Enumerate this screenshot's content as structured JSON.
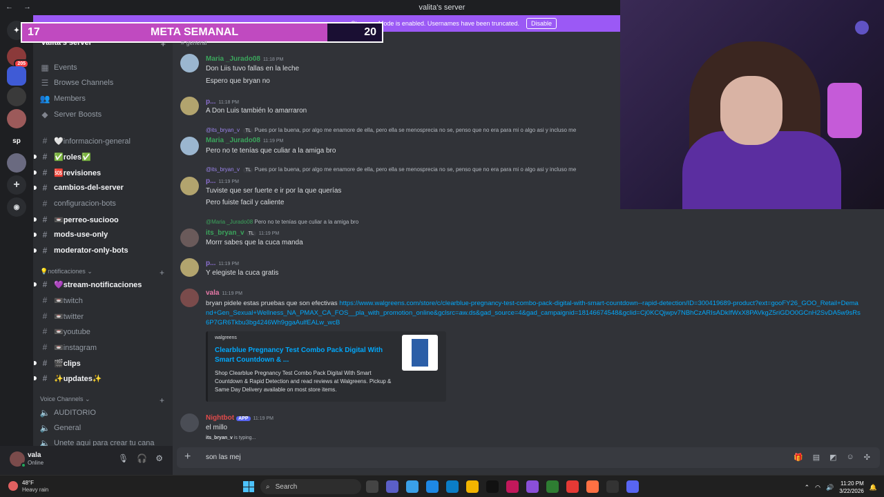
{
  "window": {
    "title": "valita's server",
    "nav": "← →"
  },
  "banner": {
    "text": "Streamer Mode is enabled. Usernames have been truncated.",
    "disable_label": "Disable"
  },
  "meta": {
    "current": "17",
    "label": "META SEMANAL",
    "goal": "20",
    "progress_fraction": 0.85
  },
  "rail": {
    "badge": "205",
    "sp_label": "sp"
  },
  "sidebar": {
    "server_name": "valita's server",
    "items": [
      {
        "label": "Events",
        "icon": "calendar-icon"
      },
      {
        "label": "Browse Channels",
        "icon": "list-icon"
      },
      {
        "label": "Members",
        "icon": "members-icon"
      },
      {
        "label": "Server Boosts",
        "icon": "boost-icon"
      }
    ],
    "channels": [
      {
        "label": "🤍informacion-general",
        "bright": false,
        "unread": false
      },
      {
        "label": "✅roles✅",
        "bright": true,
        "unread": true
      },
      {
        "label": "🆘revisiones",
        "bright": true,
        "unread": true
      },
      {
        "label": "cambios-del-server",
        "bright": true,
        "unread": true
      },
      {
        "label": "configuracion-bots",
        "bright": false,
        "unread": false
      },
      {
        "label": "📼perreo-suciooo",
        "bright": true,
        "unread": true
      },
      {
        "label": "mods-use-only",
        "bright": true,
        "unread": true
      },
      {
        "label": "moderator-only-bots",
        "bright": true,
        "unread": true
      }
    ],
    "category_notif": "💡notificaciones",
    "notif_channels": [
      {
        "label": "💜stream-notificaciones",
        "bright": true,
        "unread": true
      },
      {
        "label": "📼twitch",
        "bright": false,
        "unread": false
      },
      {
        "label": "📼twitter",
        "bright": false,
        "unread": false
      },
      {
        "label": "📼youtube",
        "bright": false,
        "unread": false
      },
      {
        "label": "📼instagram",
        "bright": false,
        "unread": false
      },
      {
        "label": "🎬clips",
        "bright": true,
        "unread": true
      },
      {
        "label": "✨updates✨",
        "bright": true,
        "unread": true
      }
    ],
    "category_voice": "Voice Channels",
    "voice_channels": [
      {
        "label": "AUDITORIO"
      },
      {
        "label": "General"
      },
      {
        "label": "Unete aqui para crear tu cana"
      }
    ]
  },
  "user": {
    "name": "vala",
    "status": "Online"
  },
  "chat": {
    "channel": "general",
    "messages": [
      {
        "author": "Maria _Jurado08",
        "time": "11:18 PM",
        "color": "#3ba55c",
        "lines": [
          "Don Liis tuvo fallas en la leche",
          "Espero que bryan no"
        ]
      },
      {
        "author": "p...",
        "time": "11:18 PM",
        "color": "#8b6fd0",
        "lines": [
          "A Don Luis también lo amarraron"
        ]
      },
      {
        "reply": "@its_bryan_v",
        "reply_text": "Pues por la buena, por algo me enamore de ella, pero ella se menosprecia no se, penso que no era para mi o algo asi y incluso me",
        "author": "Maria _Jurado08",
        "time": "11:19 PM",
        "color": "#3ba55c",
        "lines": [
          "Pero no te tenías que culiar a la amiga bro"
        ]
      },
      {
        "reply": "@its_bryan_v",
        "reply_text": "Pues por la buena, por algo me enamore de ella, pero ella se menosprecia no se, penso que no era para mi o algo asi y incluso me",
        "author": "p...",
        "time": "11:19 PM",
        "color": "#8b6fd0",
        "lines": [
          "Tuviste que ser fuerte e ir por la que querías",
          "Pero fuiste facil y caliente"
        ]
      },
      {
        "reply": "@Maria _Jurado08",
        "reply_text": "Pero no te tenías que culiar a la amiga bro",
        "author": "its_bryan_v",
        "tag": "TL",
        "time": "11:19 PM",
        "color": "#3ba55c",
        "lines": [
          "Morrr sabes que la cuca manda"
        ]
      },
      {
        "author": "p...",
        "time": "11:19 PM",
        "color": "#8b6fd0",
        "lines": [
          "Y elegiste la cuca gratis"
        ]
      },
      {
        "author": "vala",
        "time": "11:19 PM",
        "color": "#e879a8",
        "lines": [
          "bryan pidele estas pruebas que son efectivas"
        ],
        "link": "https://www.walgreens.com/store/c/clearblue-pregnancy-test-combo-pack-digital-with-smart-countdown--rapid-detection/ID=300419689-product?ext=gooFY26_GOO_Retail+Demand+Gen_Sexual+Wellness_NA_PMAX_CA_FOS__pla_with_promotion_online&gclsrc=aw.ds&gad_source=4&gad_campaignid=18146674548&gclid=Cj0KCQjwpv7NBhCzARIsADkIfWxX8PAVkgZ5riGDO0GCnH2SvDA5w9sRs6P7GR6Tkbu3bg4246Wh9ggaAulfEALw_wcB"
      },
      {
        "author": "Nightbot",
        "app": "APP",
        "time": "11:19 PM",
        "color": "#e24b4b",
        "lines": [
          "el millo"
        ]
      }
    ],
    "embed": {
      "provider": "walgreens",
      "title": "Clearblue Pregnancy Test Combo Pack Digital With Smart Countdown & ...",
      "description": "Shop Clearblue Pregnancy Test Combo Pack Digital With Smart Countdown & Rapid Detection and read reviews at Walgreens. Pickup & Same Day Delivery available on most store items."
    },
    "typing": {
      "user": "its_bryan_v",
      "text": " is typing..."
    },
    "composer_text": "son las mej"
  },
  "taskbar": {
    "temp": "48°F",
    "weather": "Heavy rain",
    "search": "Search",
    "time": "11:20 PM",
    "date": "3/22/2026"
  }
}
